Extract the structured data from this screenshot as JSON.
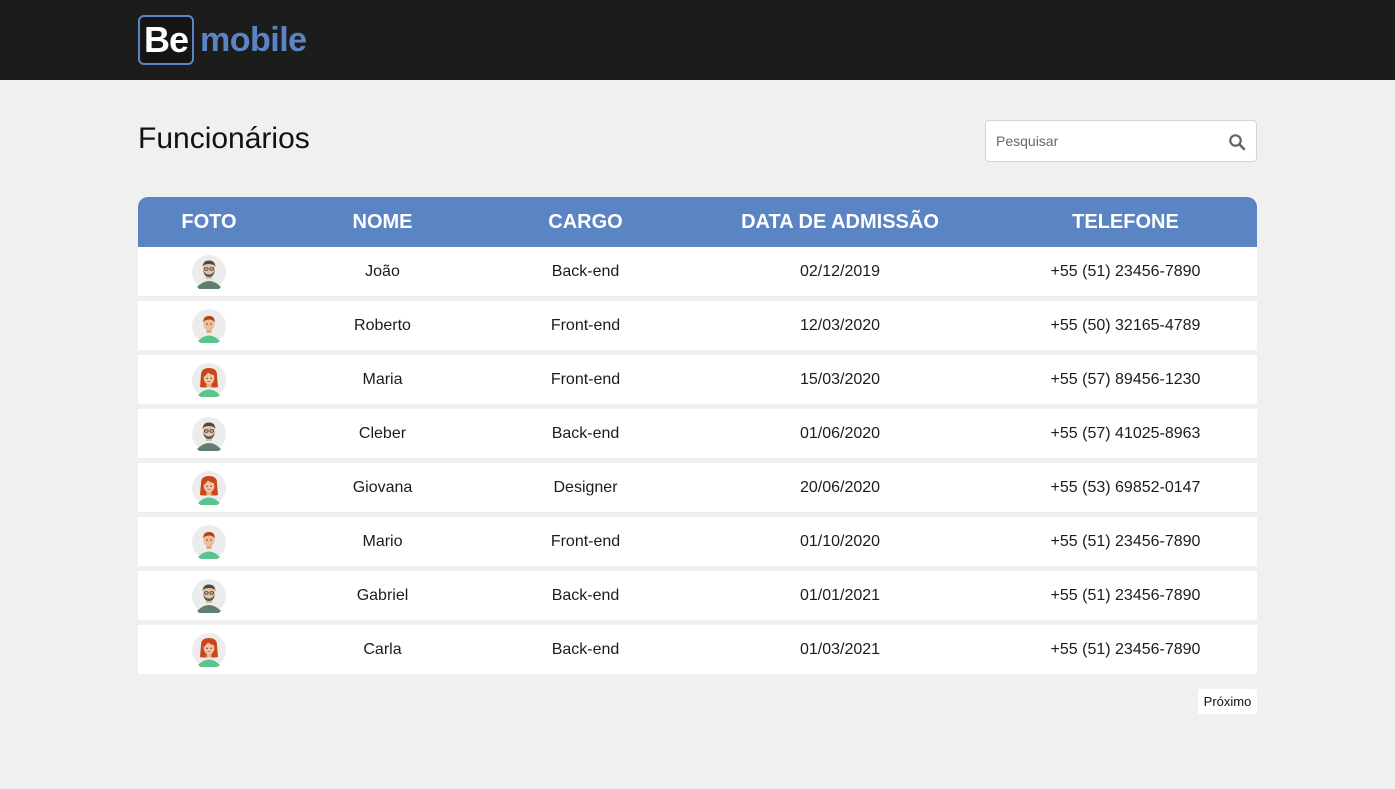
{
  "header": {
    "logo_badge": "Be",
    "logo_text": "mobile",
    "brand_color": "#5b84c4",
    "background": "#1c1c1c"
  },
  "page": {
    "title": "Funcionários"
  },
  "search": {
    "placeholder": "Pesquisar",
    "value": "",
    "icon": "search-icon"
  },
  "table": {
    "columns": [
      "FOTO",
      "NOME",
      "CARGO",
      "DATA DE ADMISSÃO",
      "TELEFONE"
    ],
    "header_color": "#5b84c4",
    "rows": [
      {
        "avatar": "man-beard-avatar",
        "name": "João",
        "job": "Back-end",
        "admission": "02/12/2019",
        "phone": "+55 (51) 23456-7890"
      },
      {
        "avatar": "young-man-avatar",
        "name": "Roberto",
        "job": "Front-end",
        "admission": "12/03/2020",
        "phone": "+55 (50) 32165-4789"
      },
      {
        "avatar": "woman-redhead-avatar",
        "name": "Maria",
        "job": "Front-end",
        "admission": "15/03/2020",
        "phone": "+55 (57) 89456-1230"
      },
      {
        "avatar": "man-beard-avatar",
        "name": "Cleber",
        "job": "Back-end",
        "admission": "01/06/2020",
        "phone": "+55 (57) 41025-8963"
      },
      {
        "avatar": "woman-redhead-avatar",
        "name": "Giovana",
        "job": "Designer",
        "admission": "20/06/2020",
        "phone": "+55 (53) 69852-0147"
      },
      {
        "avatar": "young-man-avatar",
        "name": "Mario",
        "job": "Front-end",
        "admission": "01/10/2020",
        "phone": "+55 (51) 23456-7890"
      },
      {
        "avatar": "man-beard-avatar",
        "name": "Gabriel",
        "job": "Back-end",
        "admission": "01/01/2021",
        "phone": "+55 (51) 23456-7890"
      },
      {
        "avatar": "woman-redhead-avatar",
        "name": "Carla",
        "job": "Back-end",
        "admission": "01/03/2021",
        "phone": "+55 (51) 23456-7890"
      }
    ]
  },
  "pagination": {
    "next_label": "Próximo"
  }
}
